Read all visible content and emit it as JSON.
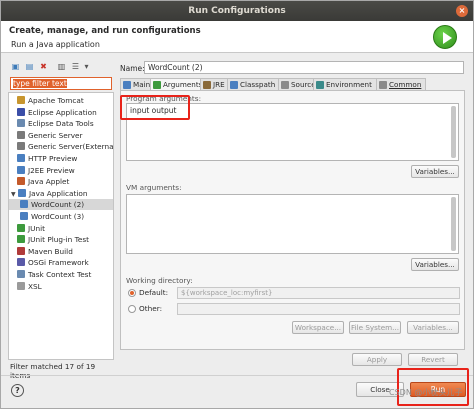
{
  "window": {
    "title": "Run Configurations",
    "close_glyph": "×"
  },
  "header": {
    "title": "Create, manage, and run configurations",
    "subtitle": "Run a Java application"
  },
  "toolbar": {
    "new": "▣",
    "dup": "▤",
    "delete": "✖",
    "collapse": "▥",
    "filter": "☰",
    "menu": "▾"
  },
  "filter": {
    "value": "type filter text"
  },
  "tree": [
    {
      "label": "Apache Tomcat",
      "icon": "tomcat-icon",
      "color": "#c8962e",
      "indent": 1
    },
    {
      "label": "Eclipse Application",
      "icon": "eclipse-icon",
      "color": "#3b4ea8",
      "indent": 1
    },
    {
      "label": "Eclipse Data Tools",
      "icon": "data-tools-icon",
      "color": "#6a8ab0",
      "indent": 1
    },
    {
      "label": "Generic Server",
      "icon": "server-icon",
      "color": "#7a7a7a",
      "indent": 1
    },
    {
      "label": "Generic Server(External La",
      "icon": "server-icon",
      "color": "#7a7a7a",
      "indent": 1
    },
    {
      "label": "HTTP Preview",
      "icon": "http-icon",
      "color": "#4a7fc0",
      "indent": 1
    },
    {
      "label": "J2EE Preview",
      "icon": "j2ee-icon",
      "color": "#4a7fc0",
      "indent": 1
    },
    {
      "label": "Java Applet",
      "icon": "applet-icon",
      "color": "#c45a2a",
      "indent": 1
    },
    {
      "label": "Java Application",
      "icon": "java-app-icon",
      "color": "#4a7fc0",
      "indent": 0,
      "expanded": true
    },
    {
      "label": "WordCount (2)",
      "icon": "java-file-icon",
      "color": "#4a7fc0",
      "indent": 2,
      "selected": true
    },
    {
      "label": "WordCount (3)",
      "icon": "java-file-icon",
      "color": "#4a7fc0",
      "indent": 2
    },
    {
      "label": "JUnit",
      "icon": "junit-icon",
      "color": "#3d9a3d",
      "indent": 1
    },
    {
      "label": "JUnit Plug-in Test",
      "icon": "junit-plugin-icon",
      "color": "#3d9a3d",
      "indent": 1
    },
    {
      "label": "Maven Build",
      "icon": "maven-icon",
      "color": "#b03a3a",
      "indent": 1
    },
    {
      "label": "OSGi Framework",
      "icon": "osgi-icon",
      "color": "#5a5aa8",
      "indent": 1
    },
    {
      "label": "Task Context Test",
      "icon": "task-icon",
      "color": "#6a8ab0",
      "indent": 1
    },
    {
      "label": "XSL",
      "icon": "xsl-icon",
      "color": "#9a9a9a",
      "indent": 1
    }
  ],
  "filter_status": "Filter matched 17 of 19 items",
  "config": {
    "name_label": "Name:",
    "name_value": "WordCount (2)"
  },
  "tabs": [
    {
      "label": "Main",
      "icon": "main-tab-icon",
      "color": "#4a7fc0"
    },
    {
      "label": "Arguments",
      "icon": "arguments-tab-icon",
      "color": "#3d9a3d",
      "active": true
    },
    {
      "label": "JRE",
      "icon": "jre-tab-icon",
      "color": "#8a6a3a"
    },
    {
      "label": "Classpath",
      "icon": "classpath-tab-icon",
      "color": "#4a7fc0"
    },
    {
      "label": "Source",
      "icon": "source-tab-icon",
      "color": "#8a8a8a"
    },
    {
      "label": "Environment",
      "icon": "environment-tab-icon",
      "color": "#3a8a8a"
    },
    {
      "label": "Common",
      "icon": "common-tab-icon",
      "color": "#8a8a8a"
    }
  ],
  "arguments": {
    "program_label": "Program arguments:",
    "program_value": "input output",
    "variables_label": "Variables...",
    "vm_label": "VM arguments:",
    "working_dir_label": "Working directory:",
    "default_label": "Default:",
    "default_value": "${workspace_loc:myfirst}",
    "other_label": "Other:",
    "workspace_btn": "Workspace...",
    "filesystem_btn": "File System...",
    "variables_btn": "Variables..."
  },
  "actions": {
    "apply": "Apply",
    "revert": "Revert",
    "close": "Close",
    "run": "Run",
    "help": "?"
  },
  "watermark": "CSDN @小枕头儿子",
  "colors": {
    "accent": "#e0622c",
    "highlight": "#e8231a",
    "titlebar": "#3d3d3a"
  }
}
